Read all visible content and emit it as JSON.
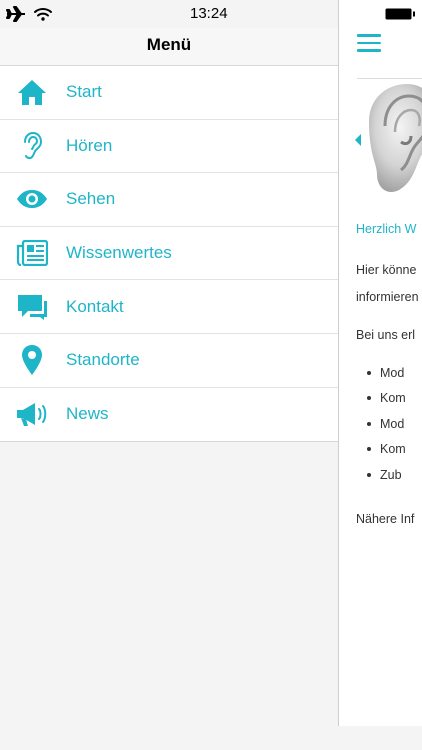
{
  "status": {
    "time": "13:24"
  },
  "menu": {
    "title": "Menü",
    "items": [
      {
        "label": "Start",
        "icon": "home-icon"
      },
      {
        "label": "Hören",
        "icon": "ear-icon"
      },
      {
        "label": "Sehen",
        "icon": "eye-icon"
      },
      {
        "label": "Wissenwertes",
        "icon": "newspaper-icon"
      },
      {
        "label": "Kontakt",
        "icon": "chat-icon"
      },
      {
        "label": "Standorte",
        "icon": "location-pin-icon"
      },
      {
        "label": "News",
        "icon": "megaphone-icon"
      }
    ]
  },
  "content": {
    "welcome": "Herzlich W",
    "paragraph1_line1": "Hier könne",
    "paragraph1_line2": "informieren",
    "paragraph2": "Bei uns erl",
    "bullets": [
      "Mod",
      "Kom",
      "Mod",
      "Kom",
      "Zub"
    ],
    "footer_text": "Nähere Inf"
  },
  "colors": {
    "accent": "#1fb5c8",
    "background": "#f4f4f4"
  }
}
